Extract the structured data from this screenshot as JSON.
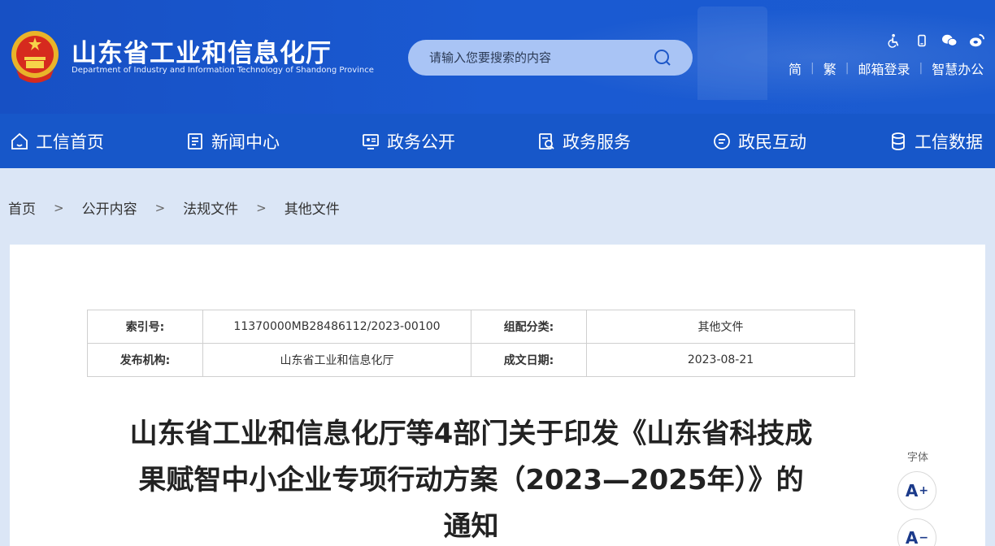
{
  "header": {
    "title": "山东省工业和信息化厅",
    "subtitle": "Department of Industry and Information Technology of Shandong Province",
    "search_placeholder": "请输入您要搜索的内容",
    "top_icons": [
      "accessibility-icon",
      "mobile-icon",
      "wechat-icon",
      "weibo-icon"
    ],
    "links": [
      "简",
      "繁",
      "邮箱登录",
      "智慧办公"
    ]
  },
  "nav": {
    "items": [
      {
        "label": "工信首页",
        "icon": "home-icon"
      },
      {
        "label": "新闻中心",
        "icon": "news-icon"
      },
      {
        "label": "政务公开",
        "icon": "open-govt-icon"
      },
      {
        "label": "政务服务",
        "icon": "service-icon"
      },
      {
        "label": "政民互动",
        "icon": "chat-icon"
      },
      {
        "label": "工信数据",
        "icon": "database-icon"
      }
    ]
  },
  "breadcrumb": [
    "首页",
    "公开内容",
    "法规文件",
    "其他文件"
  ],
  "meta": {
    "index_label": "索引号:",
    "index_value": "11370000MB28486112/2023-00100",
    "category_label": "组配分类:",
    "category_value": "其他文件",
    "issuer_label": "发布机构:",
    "issuer_value": "山东省工业和信息化厅",
    "date_label": "成文日期:",
    "date_value": "2023-08-21"
  },
  "document": {
    "title_line1": "山东省工业和信息化厅等4部门关于印发《山东省科技成",
    "title_line2": "果赋智中小企业专项行动方案（2023—2025年）》的",
    "title_line3": "通知"
  },
  "font_controls": {
    "label": "字体",
    "increase": "A",
    "decrease": "A"
  },
  "colors": {
    "header_blue": "#1a56cc",
    "nav_blue": "#1757c9",
    "page_bg": "#dbe6f6"
  }
}
